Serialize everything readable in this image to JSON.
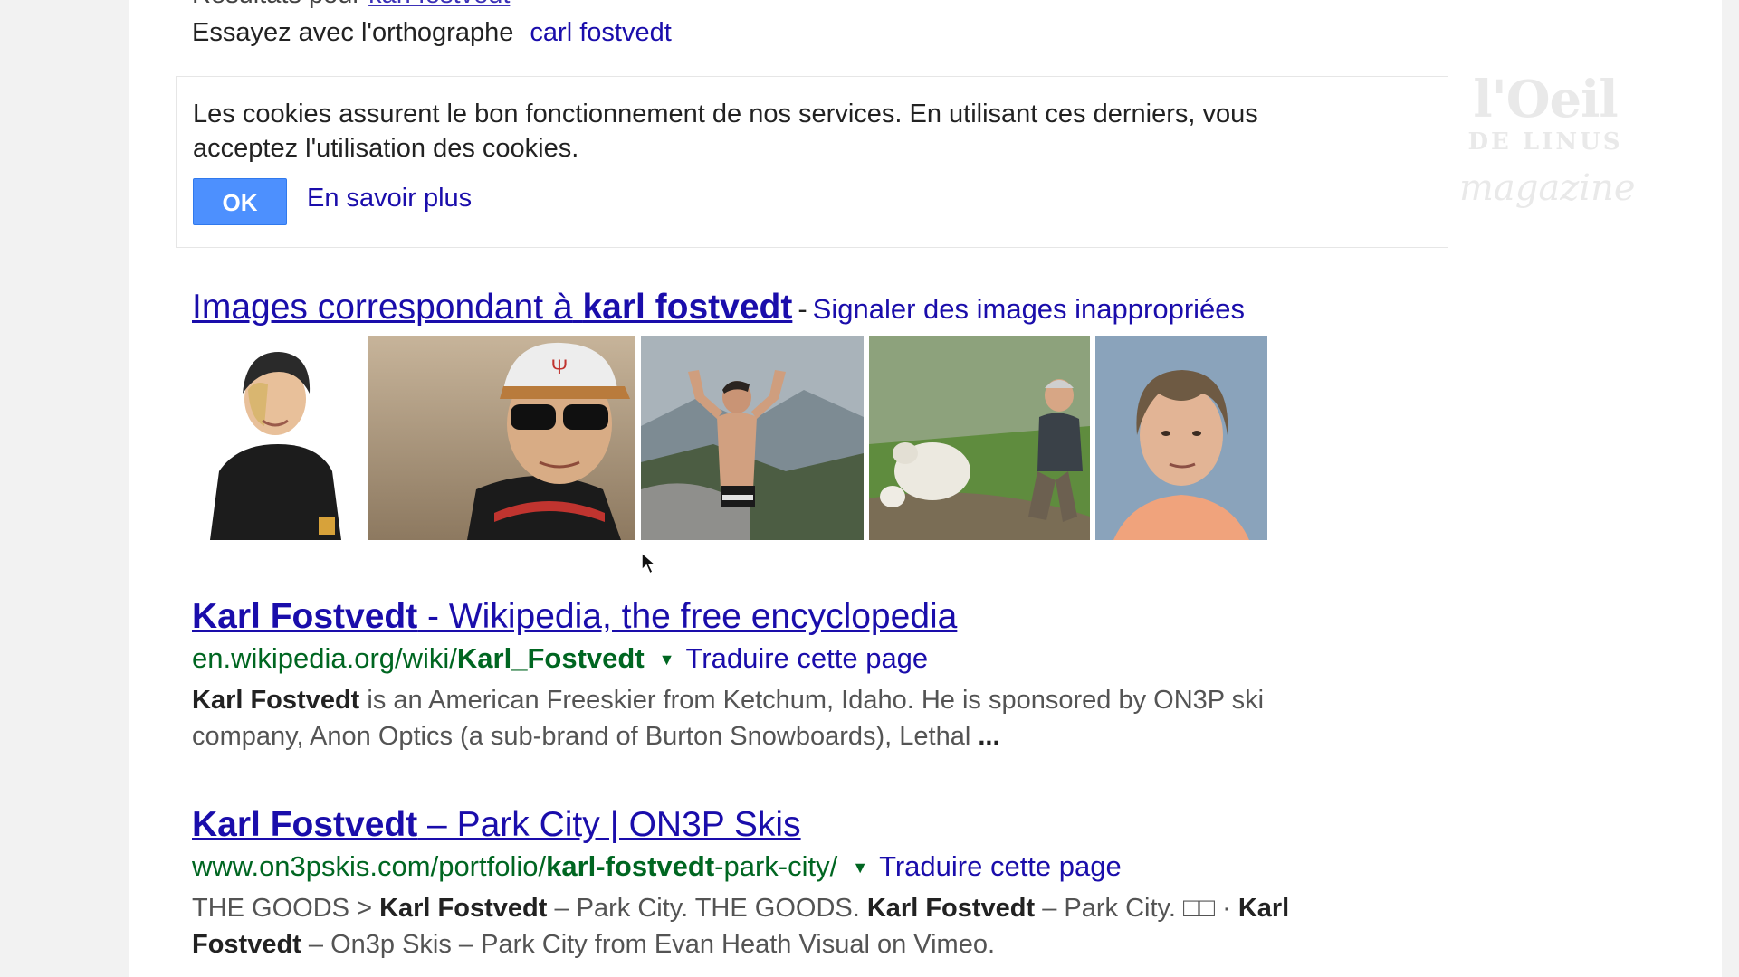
{
  "top": {
    "partial_text": "Résultats pour",
    "partial_link": "karl fostvedt",
    "spell_prefix": "Essayez avec l'orthographe",
    "spell_link": "carl fostvedt"
  },
  "cookie_notice": {
    "text": "Les cookies assurent le bon fonctionnement de nos services. En utilisant ces derniers, vous acceptez l'utilisation des cookies.",
    "ok_label": "OK",
    "learn_more": "En savoir plus"
  },
  "watermark": {
    "line1": "l'Oeil",
    "line2": "DE LINUS",
    "line3": "magazine"
  },
  "images": {
    "heading_prefix": "Images correspondant à",
    "heading_query": "karl fostvedt",
    "separator": "-",
    "report_link": "Signaler des images inappropriées",
    "thumbnails": [
      {
        "name": "helmet-portrait"
      },
      {
        "name": "cap-sunglasses-portrait"
      },
      {
        "name": "mountain-flex-photo"
      },
      {
        "name": "sheep-hike-photo"
      },
      {
        "name": "blue-background-portrait"
      }
    ]
  },
  "results": [
    {
      "title_bold": "Karl Fostvedt",
      "title_rest": " - Wikipedia, the free encyclopedia",
      "url_prefix": "en.wikipedia.org/wiki/",
      "url_bold": "Karl_Fostvedt",
      "url_suffix": "",
      "caret": "▼",
      "translate": "Traduire cette page",
      "snippet_b1": "Karl Fostvedt",
      "snippet_t1": " is an American Freeskier from Ketchum, Idaho. He is sponsored by ON3P ski company, Anon Optics (a sub-brand of Burton Snowboards), Lethal ",
      "snippet_b2": "...",
      "snippet_t2": "",
      "snippet_b3": "",
      "snippet_t3": "",
      "snippet_b4": "",
      "snippet_t4": ""
    },
    {
      "title_bold": "Karl Fostvedt",
      "title_rest": " – Park City | ON3P Skis",
      "url_prefix": "www.on3pskis.com/portfolio/",
      "url_bold": "karl-fostvedt",
      "url_suffix": "-park-city/",
      "caret": "▼",
      "translate": "Traduire cette page",
      "snippet_b1": "",
      "snippet_t1": "THE GOODS > ",
      "snippet_b2": "Karl Fostvedt",
      "snippet_t2": " – Park City. THE GOODS. ",
      "snippet_b3": "Karl Fostvedt",
      "snippet_t3": " – Park City. □□ · ",
      "snippet_b4": "Karl Fostvedt",
      "snippet_t4": " – On3p Skis – Park City from Evan Heath Visual on Vimeo."
    }
  ],
  "colors": {
    "link": "#1a0dab",
    "url_green": "#006621",
    "ok_button": "#4d90fe",
    "snippet": "#545454"
  }
}
